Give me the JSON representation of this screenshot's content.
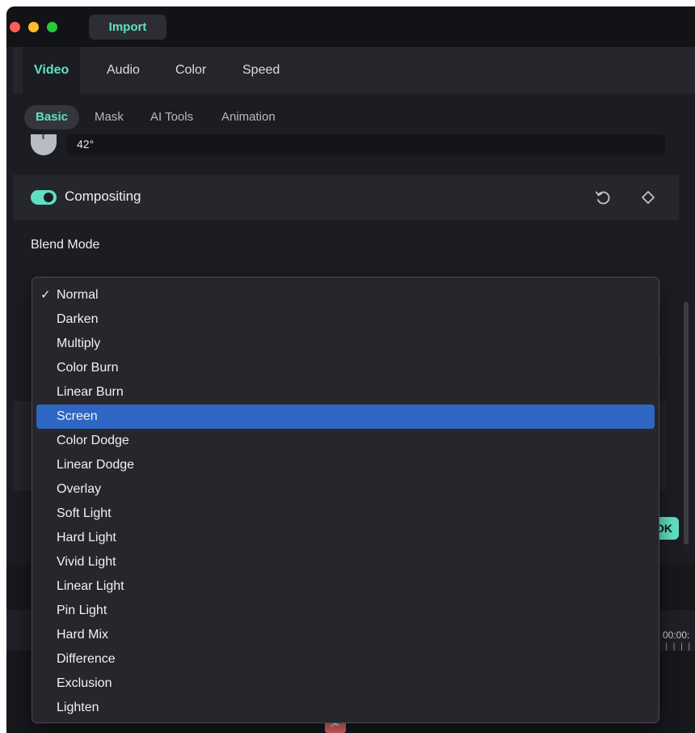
{
  "titlebar": {
    "import_label": "Import"
  },
  "main_tabs": [
    {
      "label": "Video",
      "active": true
    },
    {
      "label": "Audio",
      "active": false
    },
    {
      "label": "Color",
      "active": false
    },
    {
      "label": "Speed",
      "active": false
    }
  ],
  "sub_tabs": [
    {
      "label": "Basic",
      "active": true
    },
    {
      "label": "Mask",
      "active": false
    },
    {
      "label": "AI Tools",
      "active": false
    },
    {
      "label": "Animation",
      "active": false
    }
  ],
  "rotation": {
    "value": "42°"
  },
  "compositing": {
    "label": "Compositing",
    "enabled": true
  },
  "blend_mode": {
    "label": "Blend Mode",
    "checked": "Normal",
    "highlighted": "Screen",
    "options": [
      "Normal",
      "Darken",
      "Multiply",
      "Color Burn",
      "Linear Burn",
      "Screen",
      "Color Dodge",
      "Linear Dodge",
      "Overlay",
      "Soft Light",
      "Hard Light",
      "Vivid Light",
      "Linear Light",
      "Pin Light",
      "Hard Mix",
      "Difference",
      "Exclusion",
      "Lighten"
    ],
    "check_glyph": "✓"
  },
  "ok_button": {
    "label": "OK"
  },
  "timeline": {
    "timecode": "00:00:",
    "ticks": "| | | | |"
  },
  "colors": {
    "accent": "#5fe0c4",
    "highlight": "#2f66c4",
    "background": "#1c1d22"
  },
  "icons": {
    "reset": "reset-icon",
    "keyframe": "keyframe-diamond-icon",
    "scissor": "scissor-icon"
  }
}
